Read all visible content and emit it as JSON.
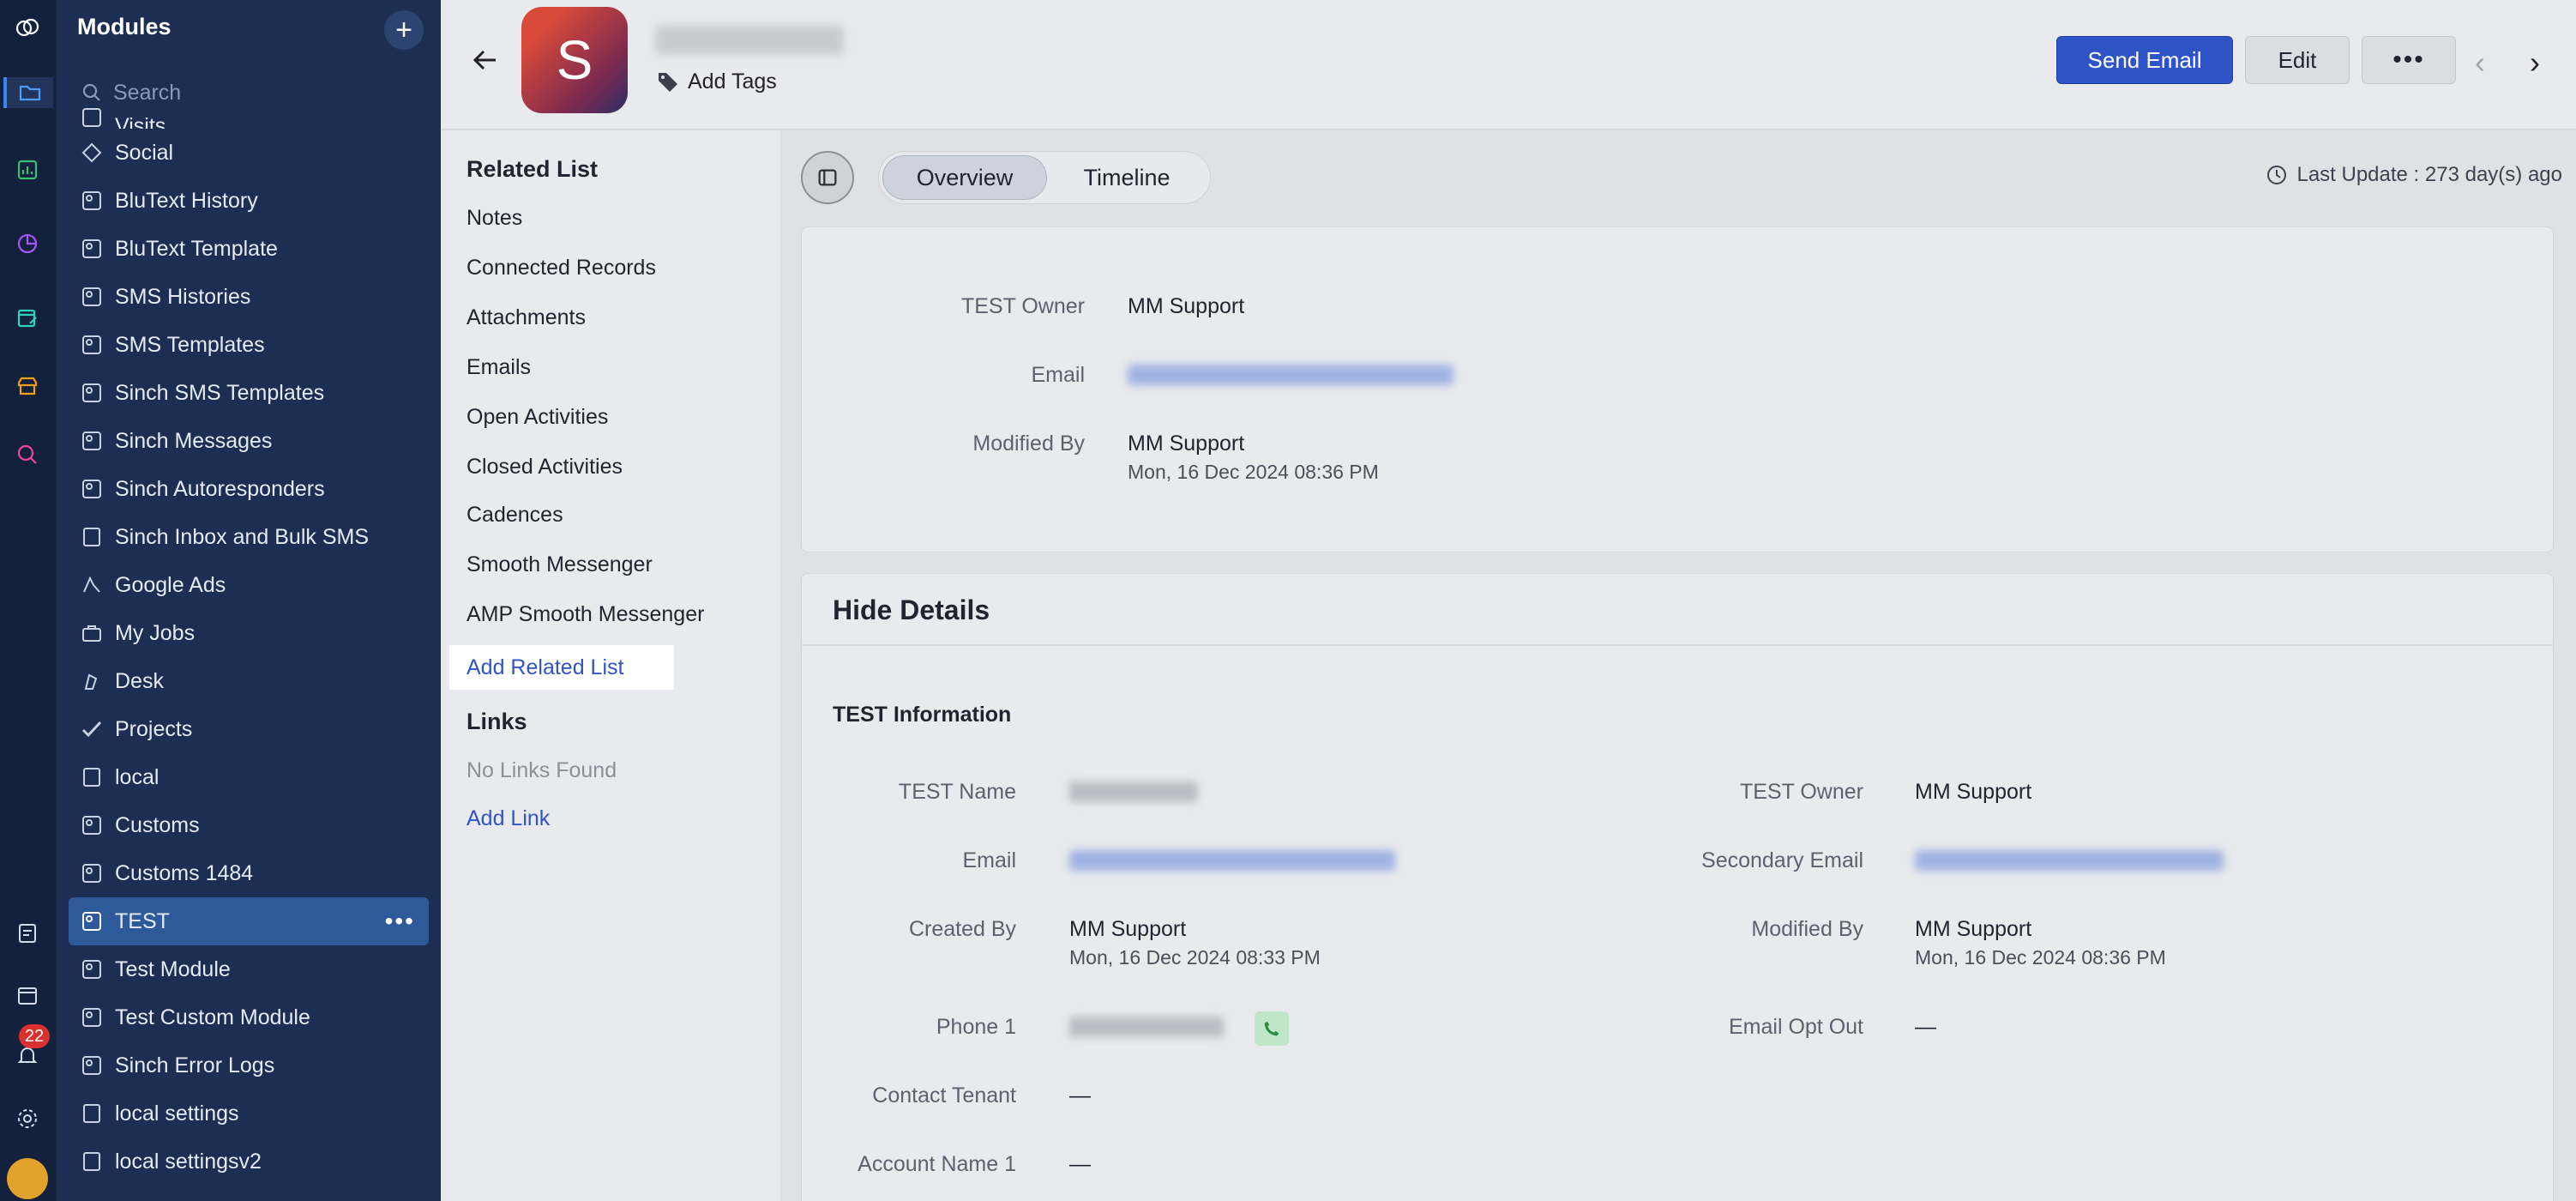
{
  "sidebar": {
    "title": "Modules",
    "search_placeholder": "Search",
    "items": [
      {
        "label": "Visits"
      },
      {
        "label": "Social"
      },
      {
        "label": "BluText History"
      },
      {
        "label": "BluText Template"
      },
      {
        "label": "SMS Histories"
      },
      {
        "label": "SMS Templates"
      },
      {
        "label": "Sinch SMS Templates"
      },
      {
        "label": "Sinch Messages"
      },
      {
        "label": "Sinch Autoresponders"
      },
      {
        "label": "Sinch Inbox and Bulk SMS"
      },
      {
        "label": "Google Ads"
      },
      {
        "label": "My Jobs"
      },
      {
        "label": "Desk"
      },
      {
        "label": "Projects"
      },
      {
        "label": "local"
      },
      {
        "label": "Customs"
      },
      {
        "label": "Customs 1484"
      },
      {
        "label": "TEST",
        "active": true
      },
      {
        "label": "Test Module"
      },
      {
        "label": "Test Custom Module"
      },
      {
        "label": "Sinch Error Logs"
      },
      {
        "label": "local settings"
      },
      {
        "label": "local settingsv2"
      }
    ]
  },
  "rail": {
    "notification_count": "22"
  },
  "header": {
    "avatar_letter": "S",
    "add_tags": "Add Tags",
    "send_email": "Send Email",
    "edit": "Edit",
    "more": "•••"
  },
  "related": {
    "title": "Related List",
    "items": [
      "Notes",
      "Connected Records",
      "Attachments",
      "Emails",
      "Open Activities",
      "Closed Activities",
      "Cadences",
      "Smooth Messenger",
      "AMP Smooth Messenger"
    ],
    "add_related": "Add Related List",
    "links_title": "Links",
    "no_links": "No Links Found",
    "add_link": "Add Link"
  },
  "main": {
    "tabs": [
      "Overview",
      "Timeline"
    ],
    "last_update": "Last Update : 273 day(s) ago",
    "overview": {
      "owner_label": "TEST Owner",
      "owner_value": "MM Support",
      "email_label": "Email",
      "modified_label": "Modified By",
      "modified_value": "MM Support",
      "modified_time": "Mon, 16 Dec 2024 08:36 PM"
    },
    "details": {
      "title": "Hide Details",
      "section_title": "TEST Information",
      "name_label": "TEST Name",
      "email_label": "Email",
      "created_label": "Created By",
      "created_value": "MM Support",
      "created_time": "Mon, 16 Dec 2024 08:33 PM",
      "phone_label": "Phone 1",
      "tenant_label": "Contact Tenant",
      "tenant_value": "—",
      "account_label": "Account Name 1",
      "account_value": "—",
      "owner_label": "TEST Owner",
      "owner_value": "MM Support",
      "secondary_email_label": "Secondary Email",
      "modified_label": "Modified By",
      "modified_value": "MM Support",
      "modified_time": "Mon, 16 Dec 2024 08:36 PM",
      "opt_out_label": "Email Opt Out",
      "opt_out_value": "—"
    }
  },
  "colors": {
    "rail_bg": "#14213d",
    "sidebar_bg": "#1c2f52",
    "active_item": "#2f5a9a",
    "primary_button": "#2f54c7",
    "link": "#2f54c7"
  }
}
